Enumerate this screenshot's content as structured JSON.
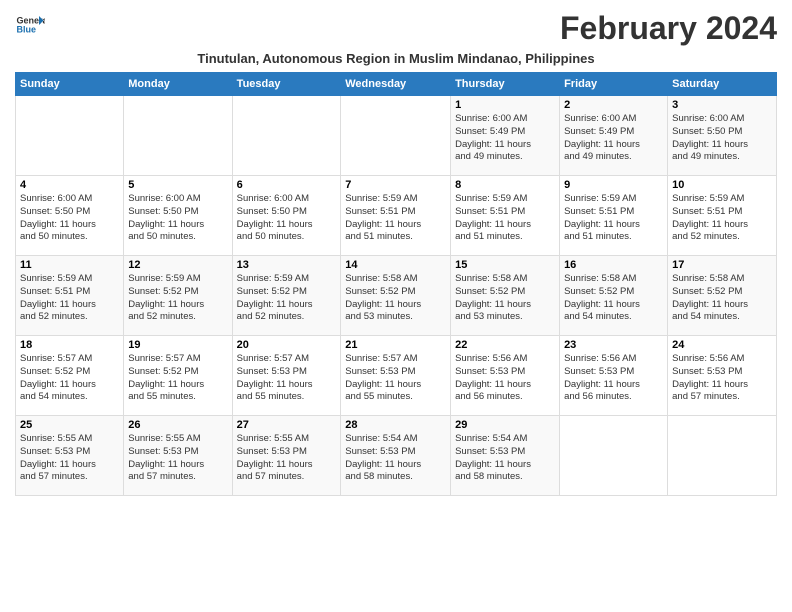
{
  "logo": {
    "general": "General",
    "blue": "Blue"
  },
  "title": "February 2024",
  "subtitle": "Tinutulan, Autonomous Region in Muslim Mindanao, Philippines",
  "headers": [
    "Sunday",
    "Monday",
    "Tuesday",
    "Wednesday",
    "Thursday",
    "Friday",
    "Saturday"
  ],
  "weeks": [
    [
      {
        "day": "",
        "info": ""
      },
      {
        "day": "",
        "info": ""
      },
      {
        "day": "",
        "info": ""
      },
      {
        "day": "",
        "info": ""
      },
      {
        "day": "1",
        "info": "Sunrise: 6:00 AM\nSunset: 5:49 PM\nDaylight: 11 hours\nand 49 minutes."
      },
      {
        "day": "2",
        "info": "Sunrise: 6:00 AM\nSunset: 5:49 PM\nDaylight: 11 hours\nand 49 minutes."
      },
      {
        "day": "3",
        "info": "Sunrise: 6:00 AM\nSunset: 5:50 PM\nDaylight: 11 hours\nand 49 minutes."
      }
    ],
    [
      {
        "day": "4",
        "info": "Sunrise: 6:00 AM\nSunset: 5:50 PM\nDaylight: 11 hours\nand 50 minutes."
      },
      {
        "day": "5",
        "info": "Sunrise: 6:00 AM\nSunset: 5:50 PM\nDaylight: 11 hours\nand 50 minutes."
      },
      {
        "day": "6",
        "info": "Sunrise: 6:00 AM\nSunset: 5:50 PM\nDaylight: 11 hours\nand 50 minutes."
      },
      {
        "day": "7",
        "info": "Sunrise: 5:59 AM\nSunset: 5:51 PM\nDaylight: 11 hours\nand 51 minutes."
      },
      {
        "day": "8",
        "info": "Sunrise: 5:59 AM\nSunset: 5:51 PM\nDaylight: 11 hours\nand 51 minutes."
      },
      {
        "day": "9",
        "info": "Sunrise: 5:59 AM\nSunset: 5:51 PM\nDaylight: 11 hours\nand 51 minutes."
      },
      {
        "day": "10",
        "info": "Sunrise: 5:59 AM\nSunset: 5:51 PM\nDaylight: 11 hours\nand 52 minutes."
      }
    ],
    [
      {
        "day": "11",
        "info": "Sunrise: 5:59 AM\nSunset: 5:51 PM\nDaylight: 11 hours\nand 52 minutes."
      },
      {
        "day": "12",
        "info": "Sunrise: 5:59 AM\nSunset: 5:52 PM\nDaylight: 11 hours\nand 52 minutes."
      },
      {
        "day": "13",
        "info": "Sunrise: 5:59 AM\nSunset: 5:52 PM\nDaylight: 11 hours\nand 52 minutes."
      },
      {
        "day": "14",
        "info": "Sunrise: 5:58 AM\nSunset: 5:52 PM\nDaylight: 11 hours\nand 53 minutes."
      },
      {
        "day": "15",
        "info": "Sunrise: 5:58 AM\nSunset: 5:52 PM\nDaylight: 11 hours\nand 53 minutes."
      },
      {
        "day": "16",
        "info": "Sunrise: 5:58 AM\nSunset: 5:52 PM\nDaylight: 11 hours\nand 54 minutes."
      },
      {
        "day": "17",
        "info": "Sunrise: 5:58 AM\nSunset: 5:52 PM\nDaylight: 11 hours\nand 54 minutes."
      }
    ],
    [
      {
        "day": "18",
        "info": "Sunrise: 5:57 AM\nSunset: 5:52 PM\nDaylight: 11 hours\nand 54 minutes."
      },
      {
        "day": "19",
        "info": "Sunrise: 5:57 AM\nSunset: 5:52 PM\nDaylight: 11 hours\nand 55 minutes."
      },
      {
        "day": "20",
        "info": "Sunrise: 5:57 AM\nSunset: 5:53 PM\nDaylight: 11 hours\nand 55 minutes."
      },
      {
        "day": "21",
        "info": "Sunrise: 5:57 AM\nSunset: 5:53 PM\nDaylight: 11 hours\nand 55 minutes."
      },
      {
        "day": "22",
        "info": "Sunrise: 5:56 AM\nSunset: 5:53 PM\nDaylight: 11 hours\nand 56 minutes."
      },
      {
        "day": "23",
        "info": "Sunrise: 5:56 AM\nSunset: 5:53 PM\nDaylight: 11 hours\nand 56 minutes."
      },
      {
        "day": "24",
        "info": "Sunrise: 5:56 AM\nSunset: 5:53 PM\nDaylight: 11 hours\nand 57 minutes."
      }
    ],
    [
      {
        "day": "25",
        "info": "Sunrise: 5:55 AM\nSunset: 5:53 PM\nDaylight: 11 hours\nand 57 minutes."
      },
      {
        "day": "26",
        "info": "Sunrise: 5:55 AM\nSunset: 5:53 PM\nDaylight: 11 hours\nand 57 minutes."
      },
      {
        "day": "27",
        "info": "Sunrise: 5:55 AM\nSunset: 5:53 PM\nDaylight: 11 hours\nand 57 minutes."
      },
      {
        "day": "28",
        "info": "Sunrise: 5:54 AM\nSunset: 5:53 PM\nDaylight: 11 hours\nand 58 minutes."
      },
      {
        "day": "29",
        "info": "Sunrise: 5:54 AM\nSunset: 5:53 PM\nDaylight: 11 hours\nand 58 minutes."
      },
      {
        "day": "",
        "info": ""
      },
      {
        "day": "",
        "info": ""
      }
    ]
  ]
}
